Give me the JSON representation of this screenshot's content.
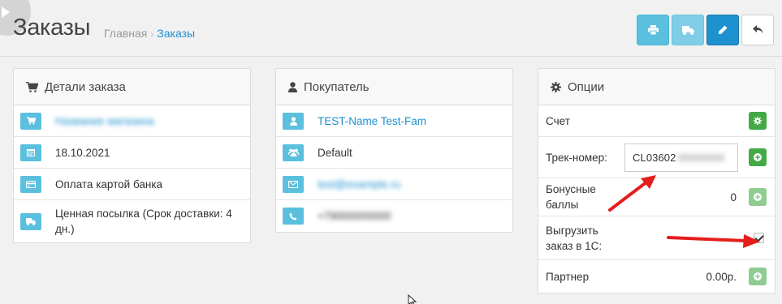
{
  "header": {
    "title": "Заказы",
    "breadcrumb": {
      "home": "Главная",
      "current": "Заказы"
    },
    "buttons": [
      "print-icon",
      "truck-icon",
      "pencil-icon",
      "reply-icon"
    ]
  },
  "order_details": {
    "title": "Детали заказа",
    "rows": [
      {
        "icon": "shopping-cart-icon",
        "text": "Название магазина"
      },
      {
        "icon": "calendar-icon",
        "text": "18.10.2021"
      },
      {
        "icon": "credit-card-icon",
        "text": "Оплата картой банка"
      },
      {
        "icon": "truck-icon",
        "text": "Ценная посылка (Срок доставки: 4 дн.)"
      }
    ]
  },
  "customer": {
    "title": "Покупатель",
    "rows": [
      {
        "icon": "user-icon",
        "text": "TEST-Name Test-Fam"
      },
      {
        "icon": "group-icon",
        "text": "Default"
      },
      {
        "icon": "envelope-icon",
        "text": "test@example.ru"
      },
      {
        "icon": "phone-icon",
        "text": "+79000000000"
      }
    ]
  },
  "options": {
    "title": "Опции",
    "invoice_label": "Счет",
    "tracking": {
      "label": "Трек-номер:",
      "value_prefix": "CL03602",
      "value_rest": "00000000"
    },
    "bonus": {
      "label": "Бонусные баллы",
      "value": "0"
    },
    "export_1c": {
      "label": "Выгрузить заказ в 1С:",
      "checked": true
    },
    "partner": {
      "label": "Партнер",
      "value": "0.00р."
    }
  },
  "colors": {
    "info": "#5bc0de",
    "primary": "#1e91cf",
    "success": "#43a947",
    "arrow": "#e61d1d"
  }
}
